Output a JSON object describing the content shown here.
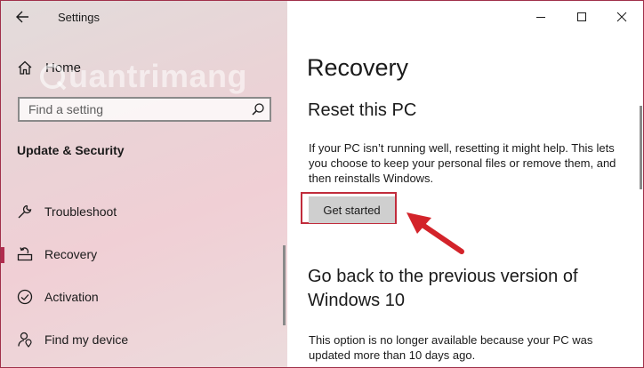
{
  "window": {
    "title": "Settings"
  },
  "sidebar": {
    "home_label": "Home",
    "search_placeholder": "Find a setting",
    "section_title": "Update & Security",
    "items": [
      {
        "label": "Troubleshoot",
        "icon": "wrench-icon",
        "active": false
      },
      {
        "label": "Recovery",
        "icon": "recovery-icon",
        "active": true
      },
      {
        "label": "Activation",
        "icon": "check-circle-icon",
        "active": false
      },
      {
        "label": "Find my device",
        "icon": "person-location-icon",
        "active": false
      }
    ],
    "watermark": "uantrimang"
  },
  "main": {
    "page_title": "Recovery",
    "reset": {
      "heading": "Reset this PC",
      "description": "If your PC isn’t running well, resetting it might help. This lets you choose to keep your personal files or remove them, and then reinstalls Windows.",
      "button_label": "Get started"
    },
    "goback": {
      "heading_line1": "Go back to the previous version of",
      "heading_line2": "Windows 10",
      "description": "This option is no longer available because your PC was updated more than 10 days ago."
    }
  },
  "colors": {
    "accent": "#b02c4e",
    "highlight_frame": "#c12c3c",
    "arrow": "#d3232a"
  }
}
